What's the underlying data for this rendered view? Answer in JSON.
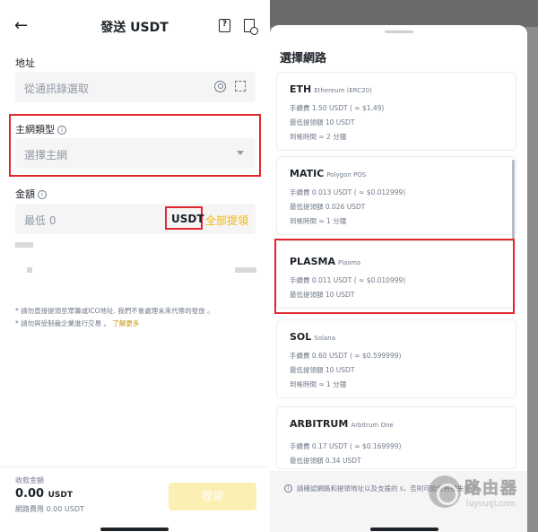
{
  "left": {
    "header": {
      "back_icon": "arrow-left-icon",
      "title": "發送 USDT",
      "help_icon": "question-doc-icon",
      "history_icon": "history-doc-icon"
    },
    "address": {
      "label": "地址",
      "placeholder": "從通訊錄選取",
      "contact_icon": "user-circle-icon",
      "scan_icon": "scan-icon"
    },
    "network": {
      "label": "主網類型",
      "info_icon": "info-icon",
      "placeholder": "選擇主網",
      "dropdown_icon": "caret-down-icon"
    },
    "amount": {
      "label": "金額",
      "info_icon": "info-icon",
      "placeholder": "最低 0",
      "unit": "USDT",
      "max_button": "全部提領"
    },
    "notes": {
      "line1": "* 請勿直接提領至眾籌或ICO地址. 我們不會處理未來代幣的發放 。",
      "line2": "* 請勿與受制裁企業進行交易 。",
      "learn_more": "了解更多"
    },
    "footer": {
      "receive_label": "收款金額",
      "receive_value": "0.00",
      "receive_unit": "USDT",
      "fee_text": "網路費用 0.00 USDT",
      "submit_button": "提領"
    }
  },
  "right": {
    "sheet_title": "選擇網路",
    "networks": [
      {
        "name": "ETH",
        "sub": "Ethereum (ERC20)",
        "fee": "手續費 1.50 USDT ( ≈ $1.49)",
        "min": "最低提領額 10 USDT",
        "time": "到帳時間 ≈ 2 分鐘"
      },
      {
        "name": "MATIC",
        "sub": "Polygon POS",
        "fee": "手續費 0.013 USDT ( ≈ $0.012999)",
        "min": "最低提領額 0.026 USDT",
        "time": "到帳時間 ≈ 1 分鐘"
      },
      {
        "name": "PLASMA",
        "sub": "Plasma",
        "fee": "手續費 0.011 USDT ( ≈ $0.010999)",
        "min": "最低提領額 10 USDT",
        "time": ""
      },
      {
        "name": "SOL",
        "sub": "Solana",
        "fee": "手續費 0.60 USDT ( ≈ $0.599999)",
        "min": "最低提領額 10 USDT",
        "time": "到帳時間 ≈ 1 分鐘"
      },
      {
        "name": "ARBITRUM",
        "sub": "Arbitrum One",
        "fee": "手續費 0.17 USDT ( ≈ $0.169999)",
        "min": "最低提領額 0.34 USDT",
        "time": ""
      }
    ],
    "footnote": "請確認網路和提領地址以及支援的   s，否則可能會將損失資產 。",
    "footnote_icon": "info-icon",
    "watermark": {
      "title": "路由器",
      "url": "luyouqi.com",
      "logo_icon": "watermark-logo-icon"
    }
  },
  "colors": {
    "accent": "#f0b90b",
    "highlight_border": "#e0282e",
    "submit_disabled": "#fcefb4",
    "text_primary": "#1e2329",
    "text_secondary": "#707a8a"
  }
}
